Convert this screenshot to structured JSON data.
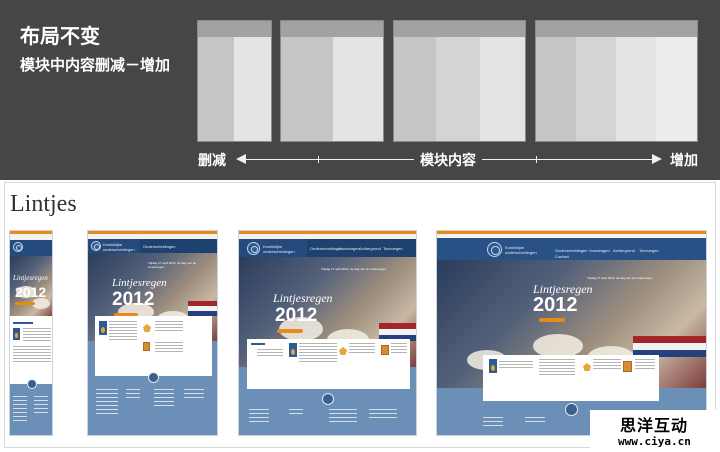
{
  "banner": {
    "title": "布局不变",
    "subtitle": "模块中内容删减－增加",
    "axis": {
      "left_label": "删减",
      "center_label": "模块内容",
      "right_label": "增加"
    }
  },
  "showcase": {
    "heading": "Lintjes",
    "site": {
      "brand_line1": "Koninklijke",
      "brand_line2": "onderscheidingen",
      "nav_items": [
        "Onderscheidingen",
        "Voordragen",
        "Achtergrond",
        "Toevoegen",
        "Contact"
      ],
      "hero_script": "Lintjesregen",
      "hero_year": "2012",
      "hero_desc": "Vrijdag 27 april 2012, de dag van de Lintjesregen",
      "card_title": "Een onderscheiding aanvragen"
    }
  },
  "watermark": {
    "text": "思洋互动",
    "url": "www.ciya.cn"
  },
  "colors": {
    "banner_bg": "#464646",
    "site_blue": "#6c8fb8",
    "nav_blue": "#254b7c",
    "accent_orange": "#e88a17"
  }
}
